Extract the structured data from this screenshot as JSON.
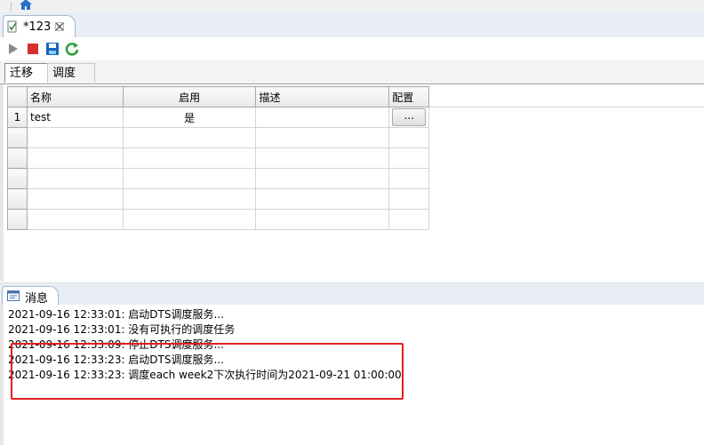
{
  "editor_tab": {
    "title": "*123"
  },
  "subtabs": {
    "active": "迁移",
    "inactive": "调度"
  },
  "grid": {
    "headers": [
      "名称",
      "启用",
      "描述",
      "配置"
    ],
    "rows": [
      {
        "num": "1",
        "name": "test",
        "enabled": "是",
        "desc": "",
        "config_button": "..."
      },
      {
        "num": "",
        "name": "",
        "enabled": "",
        "desc": "",
        "config_button": ""
      },
      {
        "num": "",
        "name": "",
        "enabled": "",
        "desc": "",
        "config_button": ""
      },
      {
        "num": "",
        "name": "",
        "enabled": "",
        "desc": "",
        "config_button": ""
      },
      {
        "num": "",
        "name": "",
        "enabled": "",
        "desc": "",
        "config_button": ""
      },
      {
        "num": "",
        "name": "",
        "enabled": "",
        "desc": "",
        "config_button": ""
      }
    ]
  },
  "messages": {
    "tab_title": "消息",
    "lines": [
      "2021-09-16 12:33:01: 启动DTS调度服务...",
      "2021-09-16 12:33:01: 没有可执行的调度任务",
      "2021-09-16 12:33:09: 停止DTS调度服务...",
      "2021-09-16 12:33:23: 启动DTS调度服务...",
      "2021-09-16 12:33:23: 调度each week2下次执行时间为2021-09-21 01:00:00"
    ]
  },
  "icons": {
    "home": "home-icon",
    "file": "file-icon",
    "close": "close-icon",
    "run": "run-icon",
    "stop": "stop-icon",
    "save": "save-icon",
    "refresh": "refresh-icon",
    "console": "console-icon"
  },
  "colors": {
    "highlight": "#e02020",
    "stop": "#d32f2f",
    "save": "#1565c0",
    "refresh": "#2e9e3e"
  }
}
